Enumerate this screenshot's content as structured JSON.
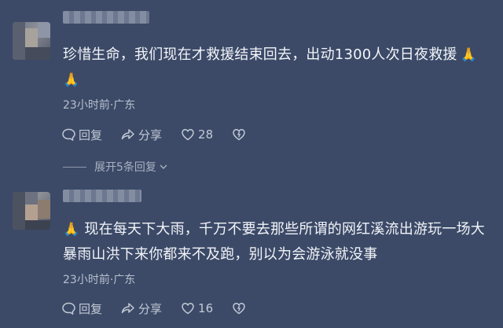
{
  "comments": [
    {
      "body": "珍惜生命，我们现在才救援结束回去，出动1300人次日夜救援",
      "emoji": "🙏🙏",
      "time_location": "23小时前·广东",
      "reply_label": "回复",
      "share_label": "分享",
      "like_count": "28",
      "expand_replies_label": "展开5条回复"
    },
    {
      "body": "现在每天下大雨，千万不要去那些所谓的网红溪流出游玩一场大暴雨山洪下来你都来不及跑，别以为会游泳就没事",
      "emoji": "🙏",
      "time_location": "23小时前·广东",
      "reply_label": "回复",
      "share_label": "分享",
      "like_count": "16"
    }
  ],
  "colors": {
    "background": "#3c4a68",
    "text": "#f2f4f8",
    "muted": "#b9c0cd"
  },
  "icons": [
    "reply-icon",
    "share-icon",
    "heart-icon",
    "dislike-heart-icon",
    "chevron-down-icon"
  ]
}
